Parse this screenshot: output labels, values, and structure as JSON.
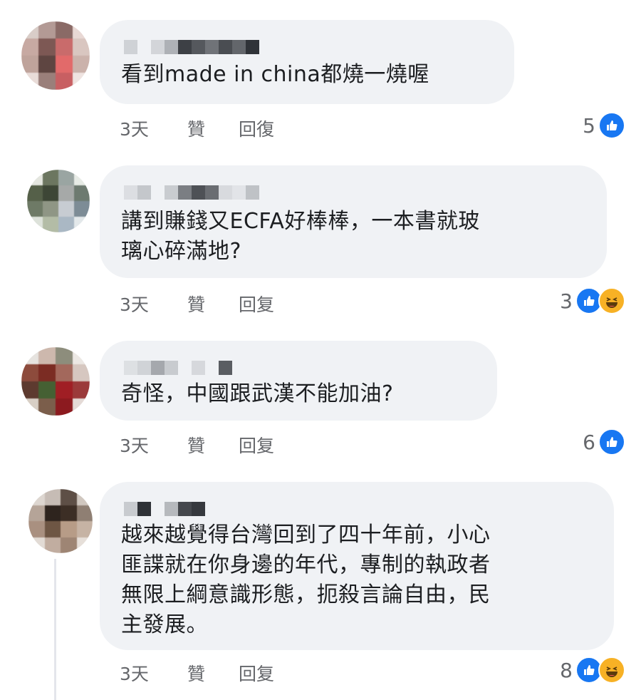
{
  "comments": [
    {
      "text": "看到made in china都燒一燒喔",
      "time": "3天",
      "like_label": "贊",
      "reply_label": "回復",
      "reaction_count": "5",
      "reactions": [
        "like-icon"
      ]
    },
    {
      "text": "講到賺錢又ECFA好棒棒，一本書就玻\n璃心碎滿地?",
      "time": "3天",
      "like_label": "贊",
      "reply_label": "回复",
      "reaction_count": "3",
      "reactions": [
        "like-icon",
        "haha-icon"
      ]
    },
    {
      "text": "奇怪，中國跟武漢不能加油?",
      "time": "3天",
      "like_label": "贊",
      "reply_label": "回复",
      "reaction_count": "6",
      "reactions": [
        "like-icon"
      ]
    },
    {
      "text": "越來越覺得台灣回到了四十年前，小心\n匪諜就在你身邊的年代，專制的執政者\n無限上綱意識形態，扼殺言論自由，民\n主發展。",
      "time": "3天",
      "like_label": "贊",
      "reply_label": "回复",
      "reaction_count": "8",
      "reactions": [
        "like-icon",
        "haha-icon"
      ]
    }
  ],
  "colors": {
    "bubble": "#f0f2f5",
    "like_blue": "#1877f2",
    "haha_yellow": "#f7b125",
    "meta_gray": "#65676b",
    "text": "#1c1e21"
  }
}
